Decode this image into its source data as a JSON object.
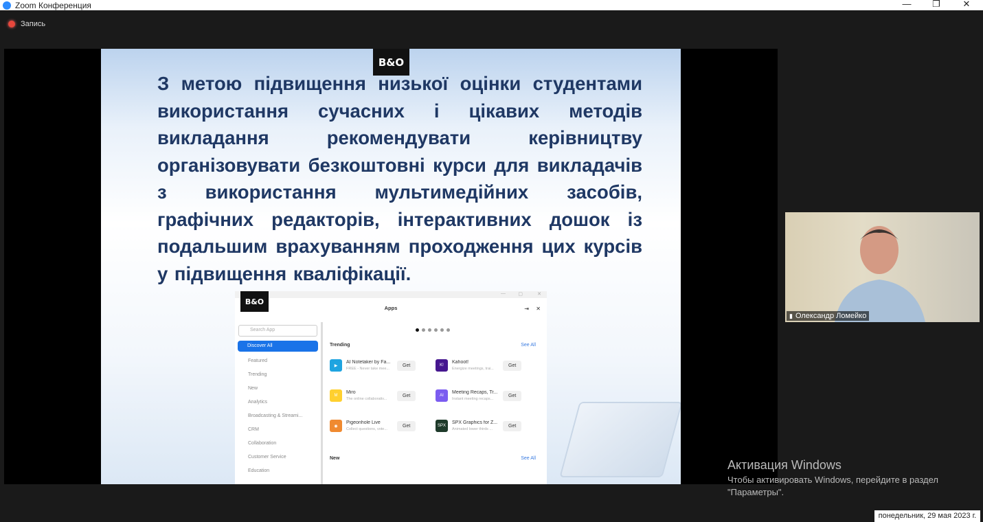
{
  "window": {
    "title": "Zoom Конференция",
    "minimize": "—",
    "restore": "❐",
    "close": "✕"
  },
  "recording": {
    "label": "Запись"
  },
  "slide": {
    "logo": "B&O",
    "text": "З метою підвищення низької оцінки студентами використання сучасних і цікавих методів викладання рекомендувати керівництву організовувати безкоштовні курси для викладачів з використання мультимедійних засобів, графічних редакторів, інтерактивних дошок із подальшим врахуванням проходження цих курсів у підвищення кваліфікації.",
    "apps_window": {
      "logo": "B&O",
      "title": "Apps",
      "window_controls": [
        "—",
        "▢",
        "✕"
      ],
      "pin": "⇥",
      "close": "✕",
      "search_placeholder": "Search App",
      "selected": "Discover All",
      "categories": [
        "Featured",
        "Trending",
        "New",
        "Analytics",
        "Broadcasting & Streami...",
        "CRM",
        "Collaboration",
        "Customer Service",
        "Education"
      ],
      "trending_label": "Trending",
      "new_label": "New",
      "see_all": "See All",
      "get": "Get",
      "apps": [
        {
          "name": "AI Notetaker by Fa...",
          "desc": "FREE - Never take mee...",
          "color": "#1fa4e0",
          "glyph": "▶"
        },
        {
          "name": "Kahoot!",
          "desc": "Energize meetings, trai...",
          "color": "#46178f",
          "glyph": "K!"
        },
        {
          "name": "Miro",
          "desc": "The online collaborativ...",
          "color": "#ffd02f",
          "glyph": "M"
        },
        {
          "name": "Meeting Recaps, Tr...",
          "desc": "Instant meeting recaps...",
          "color": "#7b5cf0",
          "glyph": "AI"
        },
        {
          "name": "Pigeonhole Live",
          "desc": "Collect questions, vote...",
          "color": "#f08a30",
          "glyph": "◉"
        },
        {
          "name": "SPX Graphics for Z...",
          "desc": "Animated lower thirds ...",
          "color": "#1e3a2a",
          "glyph": "SPX"
        }
      ]
    }
  },
  "participant": {
    "name": "Олександр Ломейко"
  },
  "activation": {
    "title": "Активация Windows",
    "subtitle": "Чтобы активировать Windows, перейдите в раздел \"Параметры\"."
  },
  "taskbar": {
    "date": "понедельник, 29 мая 2023 г."
  }
}
